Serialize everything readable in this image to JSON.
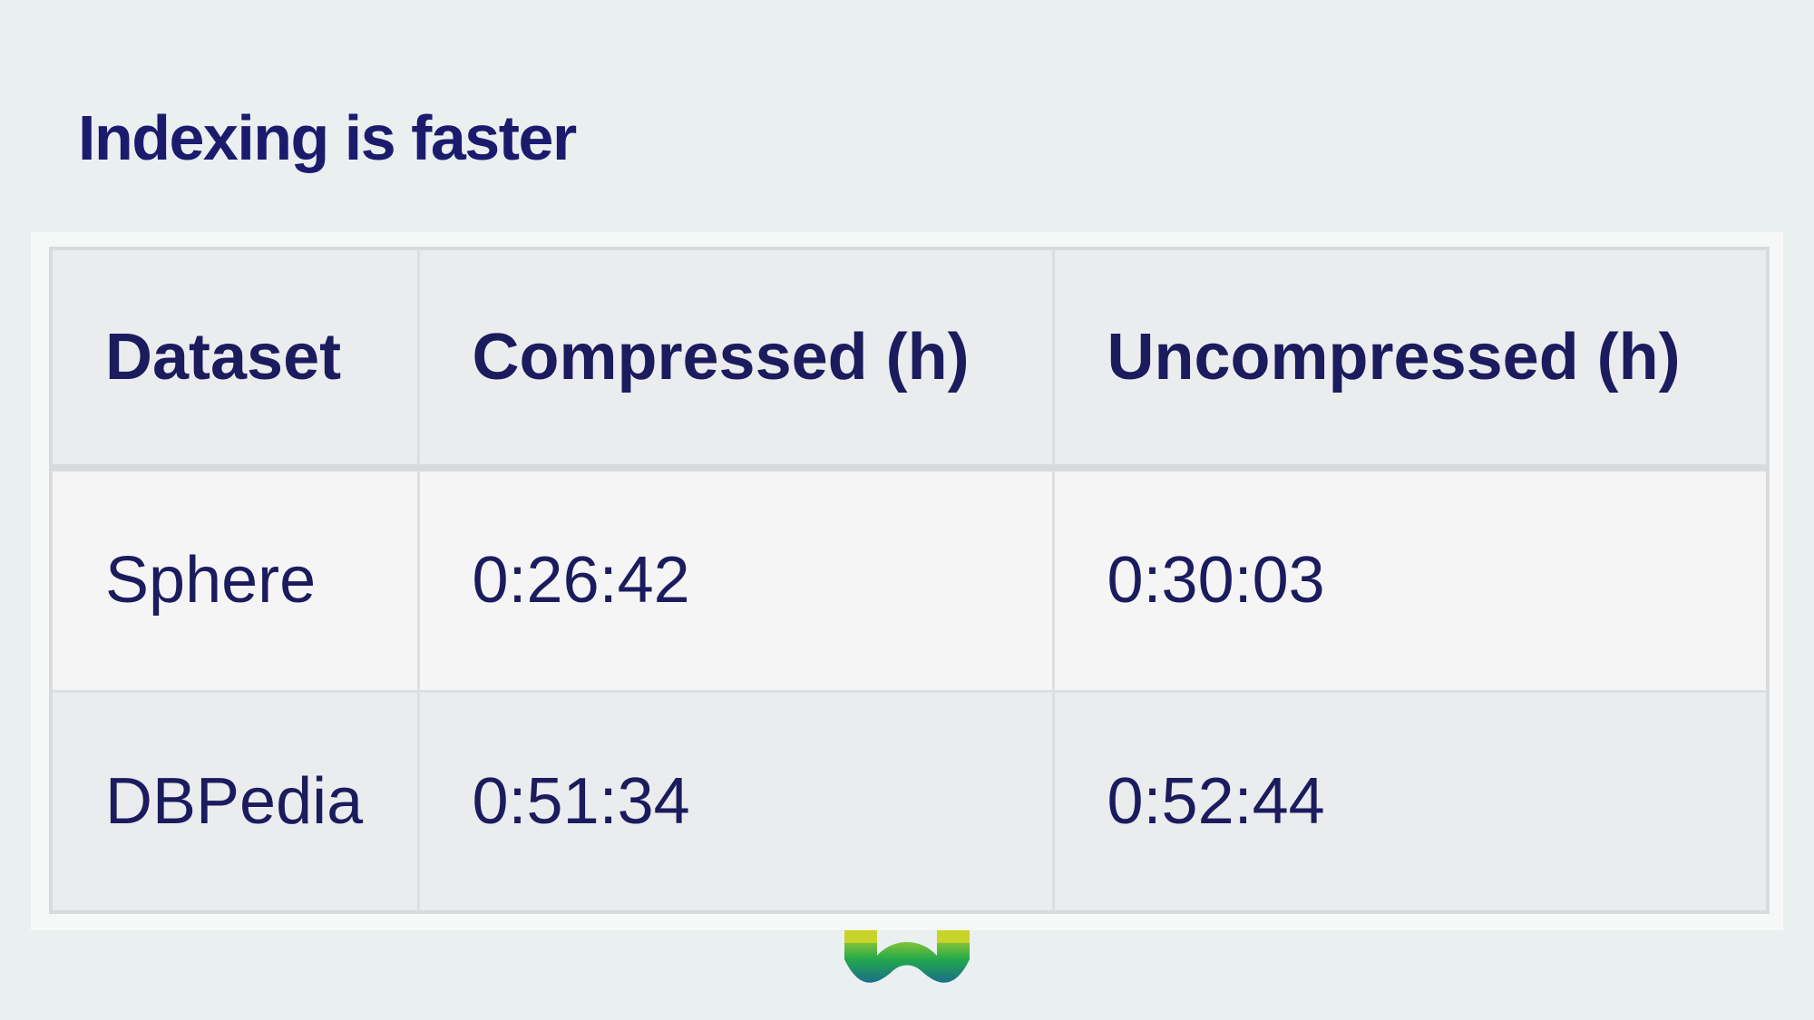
{
  "slide": {
    "title": "Indexing is faster"
  },
  "table": {
    "headers": [
      "Dataset",
      "Compressed (h)",
      "Uncompressed (h)"
    ],
    "rows": [
      [
        "Sphere",
        "0:26:42",
        "0:30:03"
      ],
      [
        "DBPedia",
        "0:51:34",
        "0:52:44"
      ]
    ]
  },
  "logo": {
    "icon": "w-logo-icon",
    "colors": [
      "#c9d42a",
      "#23a94a",
      "#1a6e8c"
    ]
  }
}
